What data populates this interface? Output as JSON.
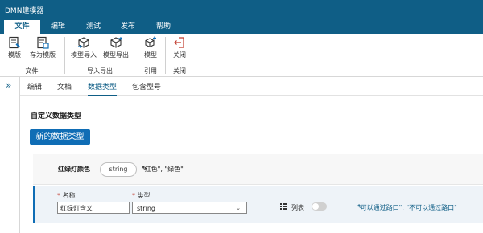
{
  "app": {
    "title": "DMN建模器"
  },
  "menu": {
    "items": [
      "文件",
      "编辑",
      "测试",
      "发布",
      "帮助"
    ]
  },
  "ribbon": {
    "buttons": {
      "template": "模版",
      "save_template": "存为模版",
      "import_model": "模型导入",
      "export_model": "模型导出",
      "model": "模型",
      "close": "关闭"
    },
    "groups": {
      "file": "文件",
      "import_export": "导入导出",
      "reference": "引用",
      "close": "关闭"
    }
  },
  "tabs": [
    "编辑",
    "文档",
    "数据类型",
    "包含型号"
  ],
  "content": {
    "section_title": "自定义数据类型",
    "new_button": "新的数据类型",
    "type_item": {
      "name": "红绿灯颜色",
      "type": "string",
      "constraint": "\"红色\", \"绿色\""
    },
    "edit_row": {
      "name_label": "名称",
      "type_label": "类型",
      "required_mark": "*",
      "name_value": "红绿灯含义",
      "type_value": "string",
      "list_label": "列表",
      "list_enabled": false,
      "constraint": "\"可以通过路口\", \"不可以通过路口\""
    }
  },
  "colors": {
    "brand": "#0f5e86",
    "primary_button": "#0f6db5"
  }
}
